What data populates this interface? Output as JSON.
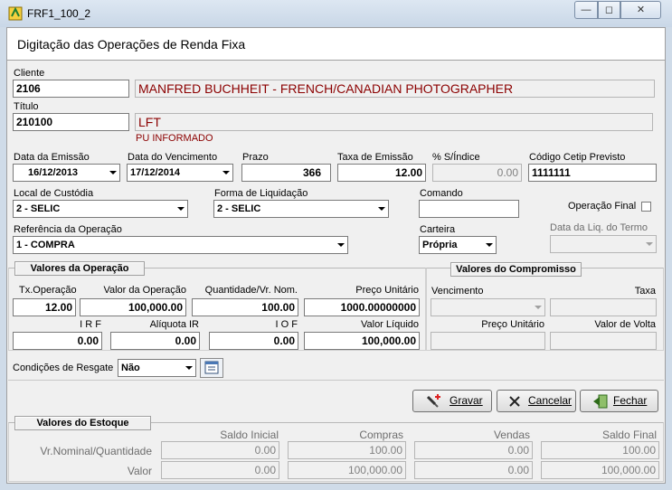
{
  "window": {
    "title": "FRF1_100_2"
  },
  "form": {
    "title": "Digitação das Operações de Renda Fixa"
  },
  "cliente": {
    "label": "Cliente",
    "code": "2106",
    "name": "MANFRED BUCHHEIT - FRENCH/CANADIAN PHOTOGRAPHER"
  },
  "titulo": {
    "label": "Título",
    "code": "210100",
    "name": "LFT",
    "note": "PU INFORMADO"
  },
  "row1": {
    "data_emissao_label": "Data da Emissão",
    "data_emissao": "16/12/2013",
    "data_vencimento_label": "Data do Vencimento",
    "data_vencimento": "17/12/2014",
    "prazo_label": "Prazo",
    "prazo": "366",
    "taxa_emissao_label": "Taxa de Emissão",
    "taxa_emissao": "12.00",
    "pct_indice_label": "% S/Índice",
    "pct_indice": "0.00",
    "cetip_label": "Código Cetip Previsto",
    "cetip": "1111111"
  },
  "row2": {
    "local_custodia_label": "Local de Custódia",
    "local_custodia": "2  - SELIC",
    "forma_liquidacao_label": "Forma de Liquidação",
    "forma_liquidacao": "2  - SELIC",
    "comando_label": "Comando",
    "comando": "",
    "operacao_final_label": "Operação Final"
  },
  "row3": {
    "referencia_label": "Referência da Operação",
    "referencia": "1  - COMPRA",
    "carteira_label": "Carteira",
    "carteira": "Própria",
    "data_liq_label": "Data da Liq. do Termo",
    "data_liq": ""
  },
  "valores_operacao": {
    "title": "Valores da Operação",
    "tx_label": "Tx.Operação",
    "tx": "12.00",
    "valor_label": "Valor da Operação",
    "valor": "100,000.00",
    "qtd_label": "Quantidade/Vr. Nom.",
    "qtd": "100.00",
    "pu_label": "Preço Unitário",
    "pu": "1000.00000000",
    "irf_label": "I R F",
    "irf": "0.00",
    "aliq_label": "Alíquota IR",
    "aliq": "0.00",
    "iof_label": "I O F",
    "iof": "0.00",
    "liquido_label": "Valor Líquido",
    "liquido": "100,000.00"
  },
  "valores_compromisso": {
    "title": "Valores do Compromisso",
    "vencimento_label": "Vencimento",
    "taxa_label": "Taxa",
    "pu_label": "Preço Unitário",
    "volta_label": "Valor de Volta"
  },
  "resgate": {
    "label": "Condições de Resgate",
    "value": "Não"
  },
  "buttons": {
    "gravar": "Gravar",
    "cancelar": "Cancelar",
    "fechar": "Fechar"
  },
  "estoque": {
    "title": "Valores do Estoque",
    "headers": [
      "Saldo Inicial",
      "Compras",
      "Vendas",
      "Saldo Final"
    ],
    "rows": [
      {
        "label": "Vr.Nominal/Quantidade",
        "values": [
          "0.00",
          "100.00",
          "0.00",
          "100.00"
        ]
      },
      {
        "label": "Valor",
        "values": [
          "0.00",
          "100,000.00",
          "0.00",
          "100,000.00"
        ]
      }
    ]
  },
  "colors": {
    "client_name": "#8b0000",
    "titlebar": "#cfdbe8"
  }
}
